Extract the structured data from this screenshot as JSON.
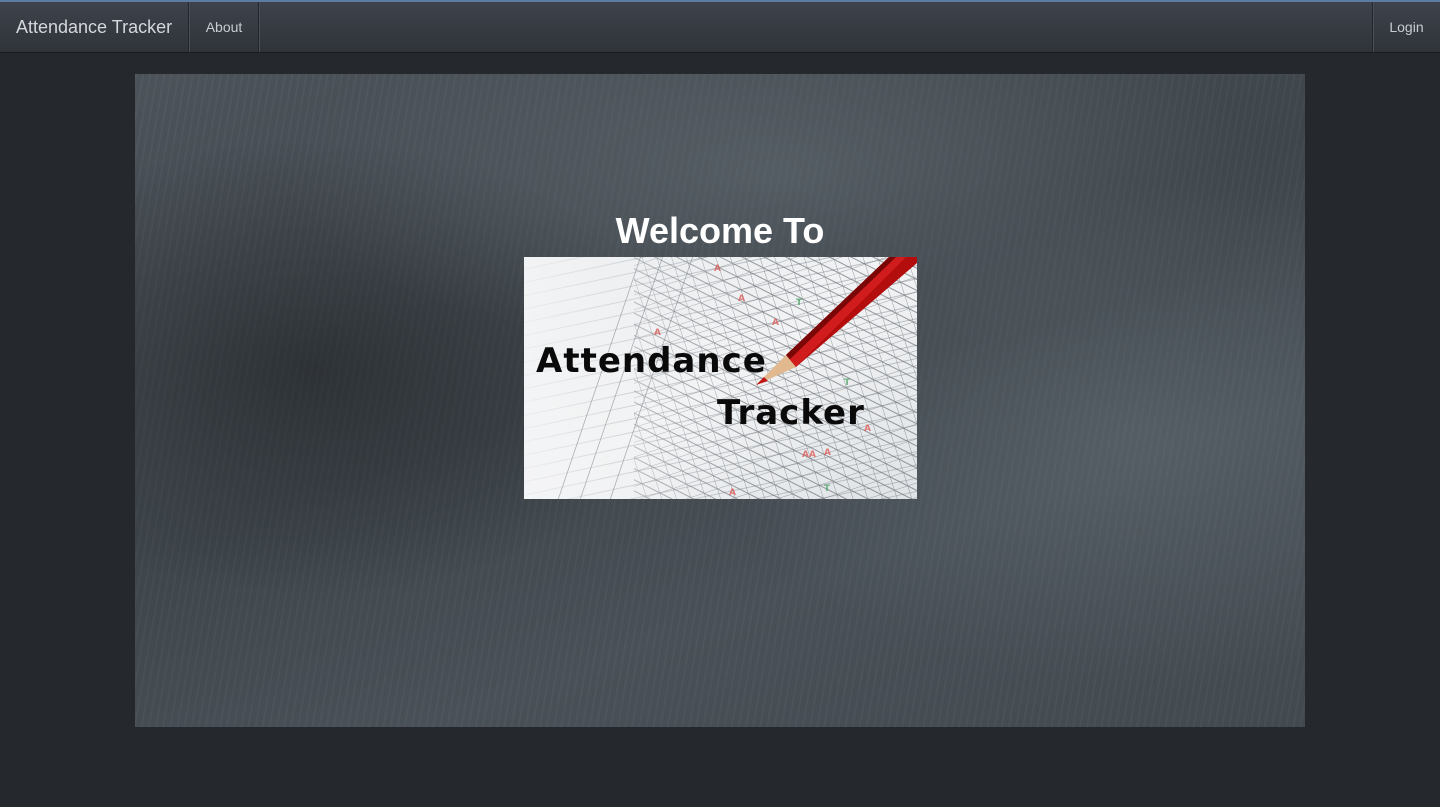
{
  "navbar": {
    "brand": "Attendance Tracker",
    "about_label": "About",
    "login_label": "Login"
  },
  "hero": {
    "heading": "Welcome To",
    "logo": {
      "line1": "Attendance",
      "line2": "Tracker"
    }
  },
  "colors": {
    "page_background": "#25282d",
    "navbar": "#383c43",
    "hero_text": "#ffffff",
    "pencil": "#b00f0f"
  },
  "icons": {
    "logo_graphic": "pencil-on-attendance-sheet"
  }
}
